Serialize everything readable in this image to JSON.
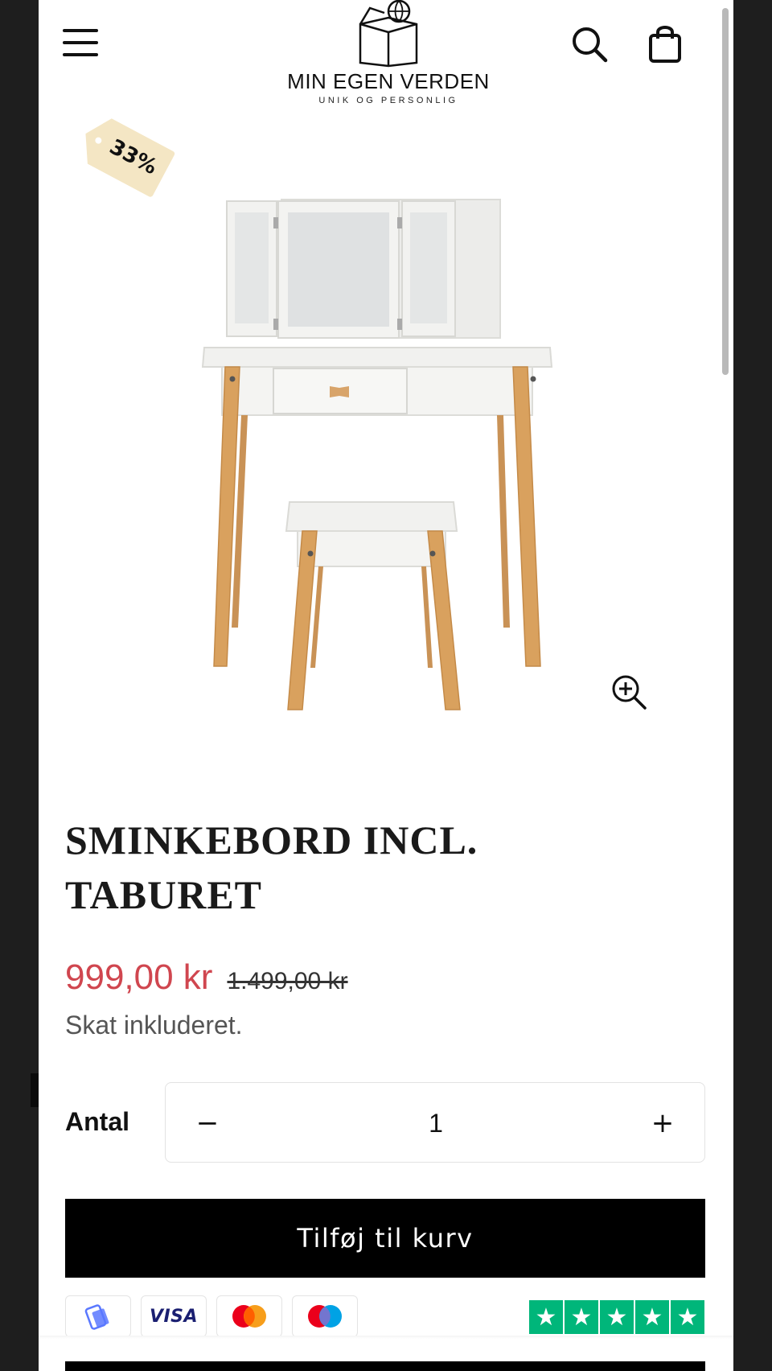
{
  "header": {
    "menu_icon": "hamburger-menu-icon",
    "logo_name": "MIN EGEN VERDEN",
    "logo_tagline": "UNIK OG PERSONLIG",
    "search_icon": "search-icon",
    "cart_icon": "shopping-bag-icon"
  },
  "badge": {
    "discount": "33%"
  },
  "product": {
    "title_line1": "SMINKEBORD INCL.",
    "title_line2": "TABURET",
    "price_sale": "999,00 kr",
    "price_original": "1.499,00 kr",
    "tax_note": "Skat inkluderet."
  },
  "quantity": {
    "label": "Antal",
    "minus": "−",
    "value": "1",
    "plus": "+"
  },
  "cart": {
    "add_label": "Tilføj til kurv"
  },
  "payments": {
    "methods": [
      "mobilepay",
      "visa",
      "mastercard",
      "maestro"
    ],
    "visa_text": "VISA"
  },
  "rating": {
    "stars": 5,
    "star": "★"
  },
  "colors": {
    "sale_price": "#d0464f",
    "badge": "#f4e6c4",
    "trustpilot": "#00b67a",
    "button": "#000000"
  }
}
